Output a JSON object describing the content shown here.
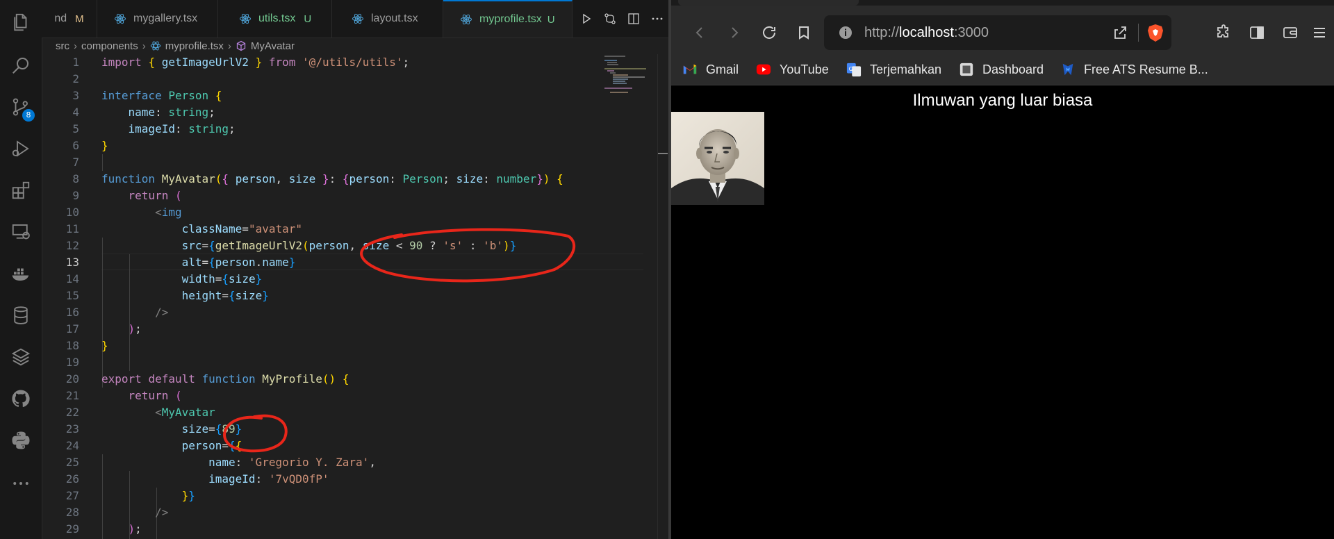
{
  "vscode": {
    "tabs": [
      {
        "label": "nd",
        "badge": "M",
        "active": false
      },
      {
        "label": "mygallery.tsx",
        "badge": "",
        "active": false
      },
      {
        "label": "utils.tsx",
        "badge": "U",
        "active": false
      },
      {
        "label": "layout.tsx",
        "badge": "",
        "active": false
      },
      {
        "label": "myprofile.tsx",
        "badge": "U",
        "active": true
      }
    ],
    "source_control_badge": "8",
    "breadcrumb": {
      "folder1": "src",
      "folder2": "components",
      "file": "myprofile.tsx",
      "symbol": "MyAvatar"
    },
    "current_line": 13,
    "line_numbers": [
      "1",
      "2",
      "3",
      "4",
      "5",
      "6",
      "7",
      "8",
      "9",
      "10",
      "11",
      "12",
      "13",
      "14",
      "15",
      "16",
      "17",
      "18",
      "19",
      "20",
      "21",
      "22",
      "23",
      "24",
      "25",
      "26",
      "27",
      "28",
      "29"
    ],
    "annotation_color": "#e8261a"
  },
  "browser": {
    "url_scheme": "http://",
    "url_host": "localhost",
    "url_port": ":3000",
    "bookmarks": [
      {
        "label": "Gmail",
        "icon": "gmail-icon"
      },
      {
        "label": "YouTube",
        "icon": "youtube-icon"
      },
      {
        "label": "Terjemahkan",
        "icon": "translate-icon"
      },
      {
        "label": "Dashboard",
        "icon": "dashboard-icon"
      },
      {
        "label": "Free ATS Resume B...",
        "icon": "resume-icon"
      }
    ],
    "page_title": "Ilmuwan yang luar biasa",
    "avatar_alt": "Gregorio Y. Zara"
  }
}
